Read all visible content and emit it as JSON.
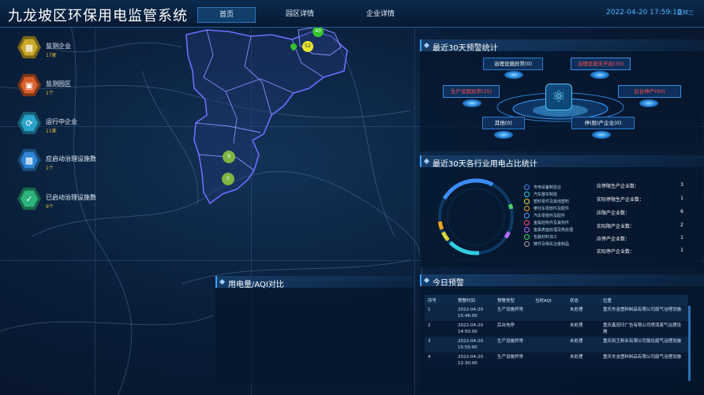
{
  "header": {
    "title": "九龙坡区环保用电监管系统",
    "tabs": [
      {
        "label": "首页",
        "active": true
      },
      {
        "label": "园区详情",
        "active": false
      },
      {
        "label": "企业详情",
        "active": false
      }
    ],
    "datetime": "2022-04-20 17:59:10",
    "user": "蓝林三"
  },
  "stats": [
    {
      "label": "监测企业",
      "value": "17家",
      "icon": "building-icon",
      "color": "#c9a92b"
    },
    {
      "label": "监测园区",
      "value": "1个",
      "icon": "park-icon",
      "color": "#d9602c"
    },
    {
      "label": "运行中企业",
      "value": "11家",
      "icon": "refresh-icon",
      "color": "#2aa3c9"
    },
    {
      "label": "应启动治理设施数",
      "value": "1个",
      "icon": "facility-icon",
      "color": "#2f86d6"
    },
    {
      "label": "已启动治理设施数",
      "value": "9个",
      "icon": "check-icon",
      "color": "#2cb37c"
    }
  ],
  "map": {
    "bubbles": [
      {
        "label": "40",
        "color": "#36c22c"
      },
      {
        "label": "52",
        "color": "#e6e62e"
      },
      {
        "label": "9",
        "color": "#7fb542"
      },
      {
        "label": "5",
        "color": "#7fb542"
      }
    ]
  },
  "alarm_panel": {
    "title": "最近30天预警统计",
    "items": [
      {
        "label": "治理设施异常(0)",
        "red": false
      },
      {
        "label": "治理设施未开启(35)",
        "red": true
      },
      {
        "label": "生产设施异常(25)",
        "red": true
      },
      {
        "label": "后台停产(60)",
        "red": true
      },
      {
        "label": "其他(0)",
        "red": false
      },
      {
        "label": "停(限)产企业(0)",
        "red": false
      }
    ]
  },
  "industry_panel": {
    "title": "最近30天各行业用电占比统计",
    "legend": [
      {
        "label": "专用设备制造业",
        "color": "#3b8cff"
      },
      {
        "label": "汽车整车制造",
        "color": "#2fd0e0"
      },
      {
        "label": "塑料零件及其他塑料",
        "color": "#d9d940"
      },
      {
        "label": "摩托车零部件及配件",
        "color": "#f0a020"
      },
      {
        "label": "汽车零部件及配件",
        "color": "#5aa0ff"
      },
      {
        "label": "金属结构件及其构件",
        "color": "#ff4d6d"
      },
      {
        "label": "金属表面处理及热处理",
        "color": "#b36bff"
      },
      {
        "label": "包装材料加工",
        "color": "#4cd36b"
      },
      {
        "label": "铸件及相关冶金制品",
        "color": "#a6a6a6"
      }
    ],
    "enterprises": [
      {
        "label": "应停限生产企业数：",
        "value": "3"
      },
      {
        "label": "实际停限生产企业数：",
        "value": "1"
      },
      {
        "label": "应限产企业数：",
        "value": "6"
      },
      {
        "label": "实际限产企业数：",
        "value": "2"
      },
      {
        "label": "应停产企业数：",
        "value": "1"
      },
      {
        "label": "实际停产企业数：",
        "value": "1"
      }
    ]
  },
  "aqi_panel": {
    "title": "用电量/AQI对比"
  },
  "today_panel": {
    "title": "今日预警",
    "columns": [
      "序号",
      "预警时间",
      "预警类型",
      "当时AQI",
      "状态",
      "位置"
    ],
    "rows": [
      {
        "no": "1",
        "time": "2022-04-20 15:46:00",
        "type": "生产设施异常",
        "aqi": "",
        "status": "未处理",
        "location": "重庆东金塑料制品有限公司废气治理设施"
      },
      {
        "no": "2",
        "time": "2022-04-20 14:50:00",
        "type": "后台充停",
        "aqi": "",
        "status": "未处理",
        "location": "重庆鑫冠印广告有限公司喷漆废气治理设施"
      },
      {
        "no": "3",
        "time": "2022-04-20 15:55:00",
        "type": "生产设施异常",
        "aqi": "",
        "status": "未处理",
        "location": "重庆凯王粉业有限公司氯化废气治理设施"
      },
      {
        "no": "4",
        "time": "2022-04-20 12:30:00",
        "type": "生产设施异常",
        "aqi": "",
        "status": "未处理",
        "location": "重庆东金塑料制品有限公司废气治理设施"
      }
    ]
  }
}
